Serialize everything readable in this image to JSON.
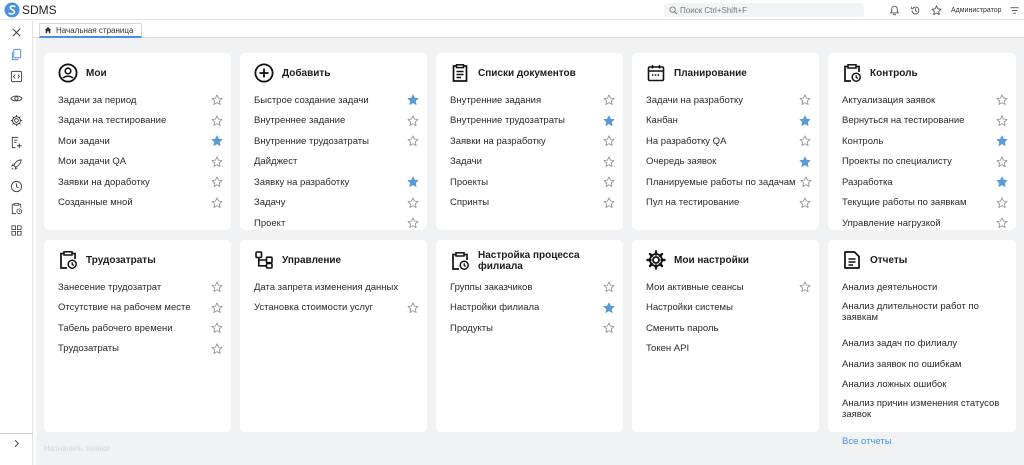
{
  "app": {
    "title": "SDMS",
    "search_placeholder": "Поиск Ctrl+Shift+F",
    "user": "Администратор",
    "brand_color": "#4a90e2"
  },
  "icons": {
    "sidebar": [
      "close-icon",
      "documents-icon",
      "code-icon",
      "eye-icon",
      "gear-icon",
      "add-task-icon",
      "rocket-icon",
      "clock-icon",
      "clipboard-clock-icon",
      "grid-icon"
    ],
    "sidebar_expand": "chevron-right-icon",
    "top": [
      "bell-icon",
      "history-icon",
      "star-icon",
      "menu-icon"
    ]
  },
  "tab": {
    "label": "Начальная страница",
    "icon": "home-icon"
  },
  "cards": [
    {
      "title": "Мои",
      "icon": "user-circle-icon",
      "items": [
        {
          "label": "Задачи за период",
          "star": false
        },
        {
          "label": "Задачи на тестирование",
          "star": false
        },
        {
          "label": "Мои задачи",
          "star": true
        },
        {
          "label": "Мои задачи QA",
          "star": false
        },
        {
          "label": "Заявки на доработку",
          "star": false
        },
        {
          "label": "Созданные мной",
          "star": false
        }
      ]
    },
    {
      "title": "Добавить",
      "icon": "plus-circle-icon",
      "items": [
        {
          "label": "Быстрое создание задачи",
          "star": true
        },
        {
          "label": "Внутреннее задание",
          "star": false
        },
        {
          "label": "Внутренние трудозатраты",
          "star": false
        },
        {
          "label": "Дайджест",
          "star": null
        },
        {
          "label": "Заявку на разработку",
          "star": true
        },
        {
          "label": "Задачу",
          "star": false
        },
        {
          "label": "Проект",
          "star": false
        }
      ]
    },
    {
      "title": "Списки документов",
      "icon": "document-list-icon",
      "items": [
        {
          "label": "Внутренние задания",
          "star": false
        },
        {
          "label": "Внутренние трудозатраты",
          "star": true
        },
        {
          "label": "Заявки на разработку",
          "star": false
        },
        {
          "label": "Задачи",
          "star": false
        },
        {
          "label": "Проекты",
          "star": false
        },
        {
          "label": "Спринты",
          "star": false
        }
      ]
    },
    {
      "title": "Планирование",
      "icon": "calendar-icon",
      "items": [
        {
          "label": "Задачи на разработку",
          "star": false
        },
        {
          "label": "Канбан",
          "star": true
        },
        {
          "label": "На разработку QA",
          "star": false
        },
        {
          "label": "Очередь заявок",
          "star": true
        },
        {
          "label": "Планируемые работы по задачам",
          "star": false
        },
        {
          "label": "Пул на тестирование",
          "star": false
        }
      ]
    },
    {
      "title": "Контроль",
      "icon": "clipboard-clock-icon",
      "items": [
        {
          "label": "Актуализация заявок",
          "star": false
        },
        {
          "label": "Вернуться на тестирование",
          "star": false
        },
        {
          "label": "Контроль",
          "star": true
        },
        {
          "label": "Проекты по специалисту",
          "star": false
        },
        {
          "label": "Разработка",
          "star": true
        },
        {
          "label": "Текущие работы по заявкам",
          "star": false
        },
        {
          "label": "Управление нагрузкой",
          "star": false
        }
      ]
    },
    {
      "title": "Трудозатраты",
      "icon": "clipboard-clock-icon",
      "items": [
        {
          "label": "Занесение трудозатрат",
          "star": false
        },
        {
          "label": "Отсутствие на рабочем месте",
          "star": false
        },
        {
          "label": "Табель рабочего времени",
          "star": false
        },
        {
          "label": "Трудозатраты",
          "star": false
        }
      ]
    },
    {
      "title": "Управление",
      "icon": "hierarchy-icon",
      "items": [
        {
          "label": "Дата запрета изменения данных",
          "star": null
        },
        {
          "label": "Установка стоимости услуг",
          "star": false
        }
      ]
    },
    {
      "title": "Настройка процесса филиала",
      "icon": "clipboard-clock-icon",
      "items": [
        {
          "label": "Группы заказчиков",
          "star": false
        },
        {
          "label": "Настройки филиала",
          "star": true
        },
        {
          "label": "Продукты",
          "star": false
        }
      ]
    },
    {
      "title": "Мои настройки",
      "icon": "gear-icon",
      "items": [
        {
          "label": "Мои активные сеансы",
          "star": false
        },
        {
          "label": "Настройки системы",
          "star": null
        },
        {
          "label": "Сменить пароль",
          "star": null
        },
        {
          "label": "Токен API",
          "star": null
        }
      ]
    },
    {
      "title": "Отчеты",
      "icon": "report-icon",
      "items": [
        {
          "label": "Анализ деятельности",
          "star": null
        },
        {
          "label": "Анализ длительности работ по заявкам",
          "star": null,
          "two_line": true
        },
        {
          "label": "Анализ задач по филиалу",
          "star": null
        },
        {
          "label": "Анализ заявок по ошибкам",
          "star": null
        },
        {
          "label": "Анализ ложных ошибок",
          "star": null
        },
        {
          "label": "Анализ причин изменения статусов заявок",
          "star": null,
          "two_line": true
        },
        {
          "label": "Все отчеты",
          "star": null,
          "link": true
        }
      ]
    }
  ],
  "footer": {
    "link": "Назначить заявки"
  }
}
